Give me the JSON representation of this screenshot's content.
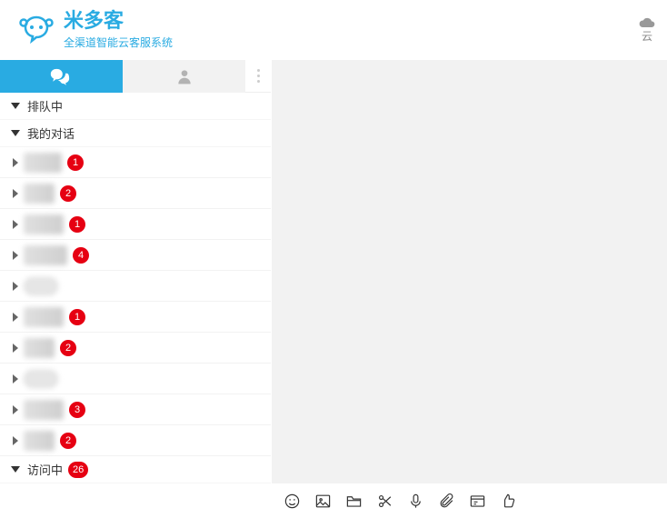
{
  "header": {
    "brand_title": "米多客",
    "brand_subtitle": "全渠道智能云客服系统",
    "cloud_label": "云"
  },
  "sections": {
    "queue": "排队中",
    "my_convo": "我的对话",
    "visiting": "访问中"
  },
  "conversations": [
    {
      "badge": 1
    },
    {
      "badge": 2
    },
    {
      "badge": 1
    },
    {
      "badge": 4
    },
    {
      "badge": null
    },
    {
      "badge": 1
    },
    {
      "badge": 2
    },
    {
      "badge": null
    },
    {
      "badge": 3
    },
    {
      "badge": 2
    }
  ],
  "visiting_badge": 26,
  "toolbar_icons": [
    "emoji",
    "image",
    "folder",
    "scissors",
    "mic",
    "attachment",
    "card",
    "thumbs-up"
  ]
}
